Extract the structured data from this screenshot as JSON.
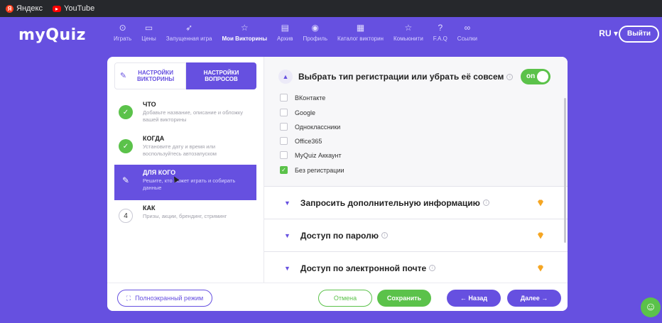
{
  "bookmarks": [
    {
      "label": "Яндекс",
      "icon": "yandex-icon",
      "glyph": "Я"
    },
    {
      "label": "YouTube",
      "icon": "youtube-icon",
      "glyph": "▸"
    }
  ],
  "header": {
    "logo": "myQuiz",
    "nav": [
      {
        "label": "Играть",
        "icon": "gamepad-icon",
        "glyph": "⊙"
      },
      {
        "label": "Цены",
        "icon": "wallet-icon",
        "glyph": "▭"
      },
      {
        "label": "Запущенная игра",
        "icon": "rocket-icon",
        "glyph": "➶"
      },
      {
        "label": "Мои Викторины",
        "icon": "star-outline-icon",
        "glyph": "☆"
      },
      {
        "label": "Архив",
        "icon": "archive-icon",
        "glyph": "▤"
      },
      {
        "label": "Профиль",
        "icon": "user-icon",
        "glyph": "◉"
      },
      {
        "label": "Каталог викторин",
        "icon": "catalog-icon",
        "glyph": "▦"
      },
      {
        "label": "Комьюнити",
        "icon": "star-icon",
        "glyph": "☆"
      },
      {
        "label": "F.A.Q",
        "icon": "help-icon",
        "glyph": "?"
      },
      {
        "label": "Ссылки",
        "icon": "link-icon",
        "glyph": "∞"
      }
    ],
    "active_nav": "Мои Викторины",
    "lang": "RU ▾",
    "logout": "Выйти"
  },
  "tabs": {
    "quiz_settings": "НАСТРОЙКИ ВИКТОРИНЫ",
    "question_settings": "НАСТРОЙКИ ВОПРОСОВ"
  },
  "steps": [
    {
      "title": "ЧТО",
      "desc": "Добавьте название, описание и обложку вашей викторины",
      "state": "done",
      "glyph": "✓"
    },
    {
      "title": "КОГДА",
      "desc": "Установите дату и время или воспользуйтесь автозапуском",
      "state": "done",
      "glyph": "✓"
    },
    {
      "title": "ДЛЯ КОГО",
      "desc": "Решите, кто может играть и собирать данные",
      "state": "active",
      "glyph": "✎"
    },
    {
      "title": "КАК",
      "desc": "Призы, акции, брендинг, стриминг",
      "state": "todo",
      "glyph": "4"
    }
  ],
  "registration": {
    "title": "Выбрать тип регистрации или убрать её совсем",
    "toggle": "on",
    "options": [
      {
        "label": "ВКонтакте",
        "checked": false
      },
      {
        "label": "Google",
        "checked": false
      },
      {
        "label": "Одноклассники",
        "checked": false
      },
      {
        "label": "Office365",
        "checked": false
      },
      {
        "label": "MyQuiz Аккаунт",
        "checked": false
      },
      {
        "label": "Без регистрации",
        "checked": true
      }
    ]
  },
  "sections": [
    {
      "title": "Запросить дополнительную информацию"
    },
    {
      "title": "Доступ по паролю"
    },
    {
      "title": "Доступ по электронной почте"
    }
  ],
  "footer": {
    "fullscreen": "Полноэкранный режим",
    "cancel": "Отмена",
    "save": "Сохранить",
    "back": "← Назад",
    "next": "Далее →"
  },
  "colors": {
    "accent": "#6650e0",
    "success": "#5bc24a",
    "premium": "#f5a623"
  }
}
